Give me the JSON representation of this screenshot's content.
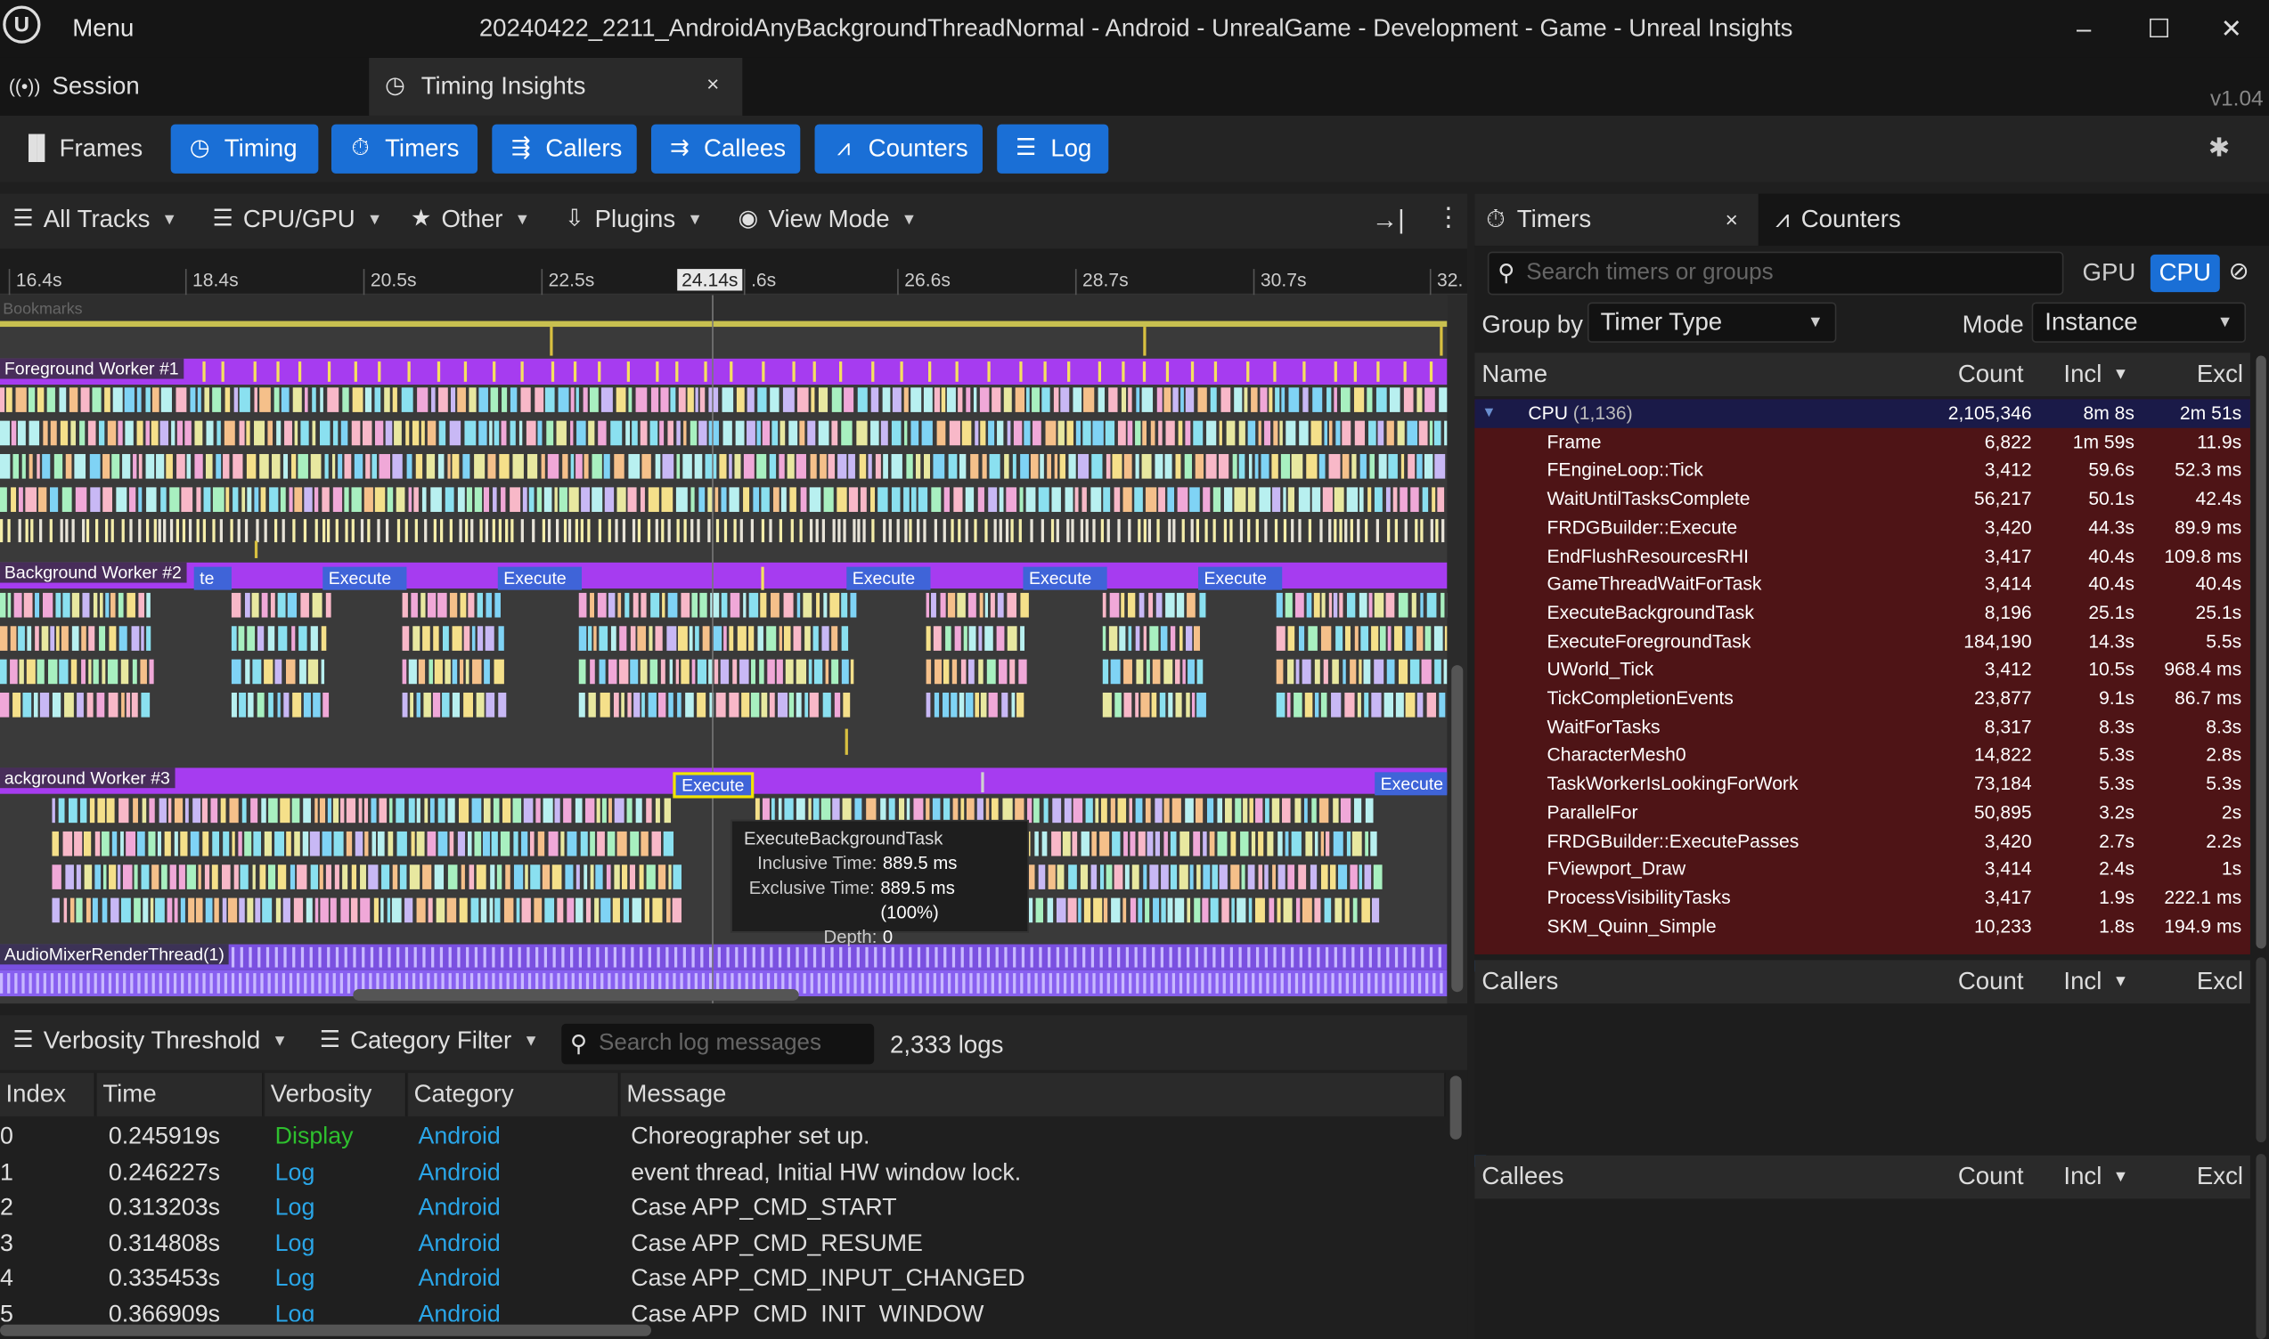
{
  "window": {
    "menu_label": "Menu",
    "title": "20240422_2211_AndroidAnyBackgroundThreadNormal - Android - UnrealGame - Development - Game - Unreal Insights",
    "version": "v1.04"
  },
  "tabs": {
    "session": "Session",
    "timing": "Timing Insights",
    "close": "×"
  },
  "toolbar": {
    "frames": "Frames",
    "timing": "Timing",
    "timers": "Timers",
    "callers": "Callers",
    "callees": "Callees",
    "counters": "Counters",
    "log": "Log"
  },
  "timing_view": {
    "filters": [
      "All Tracks",
      "CPU/GPU",
      "Other",
      "Plugins",
      "View Mode"
    ],
    "ruler_ticks": [
      "16.4s",
      "18.4s",
      "20.5s",
      "22.5s",
      "24.14s",
      ".6s",
      "26.6s",
      "28.7s",
      "30.7s",
      "32."
    ],
    "bookmarks": "Bookmarks",
    "tracks": {
      "fg1": "Foreground Worker #1",
      "bg2": "Background Worker #2",
      "bg3": "ackground Worker #3",
      "audio": "AudioMixerRenderThread(1)"
    },
    "execute_label": "Execute",
    "execute_partial": "te",
    "tooltip": {
      "name": "ExecuteBackgroundTask",
      "inclusive_label": "Inclusive Time:",
      "inclusive_value": "889.5 ms",
      "exclusive_label": "Exclusive Time:",
      "exclusive_value": "889.5 ms (100%)",
      "depth_label": "Depth:",
      "depth_value": "0"
    }
  },
  "log_view": {
    "verbosity_filter": "Verbosity Threshold",
    "category_filter": "Category Filter",
    "search_placeholder": "Search log messages",
    "count": "2,333 logs",
    "columns": [
      "Index",
      "Time",
      "Verbosity",
      "Category",
      "Message"
    ],
    "rows": [
      {
        "index": "0",
        "time": "0.245919s",
        "verbosity": "Display",
        "category": "Android",
        "message": "Choreographer set up."
      },
      {
        "index": "1",
        "time": "0.246227s",
        "verbosity": "Log",
        "category": "Android",
        "message": "event thread, Initial HW window lock."
      },
      {
        "index": "2",
        "time": "0.313203s",
        "verbosity": "Log",
        "category": "Android",
        "message": "Case APP_CMD_START"
      },
      {
        "index": "3",
        "time": "0.314808s",
        "verbosity": "Log",
        "category": "Android",
        "message": "Case APP_CMD_RESUME"
      },
      {
        "index": "4",
        "time": "0.335453s",
        "verbosity": "Log",
        "category": "Android",
        "message": "Case APP_CMD_INPUT_CHANGED"
      },
      {
        "index": "5",
        "time": "0.366909s",
        "verbosity": "Log",
        "category": "Android",
        "message": "Case APP_CMD_INIT_WINDOW"
      }
    ],
    "colors": {
      "display": "#2ec02e",
      "log": "#2aa6e8",
      "category": "#2aa6e8"
    }
  },
  "timers_panel": {
    "tab_timers": "Timers",
    "tab_counters": "Counters",
    "search_placeholder": "Search timers or groups",
    "gpu": "GPU",
    "cpu": "CPU",
    "group_by_label": "Group by",
    "group_by_value": "Timer Type",
    "mode_label": "Mode",
    "mode_value": "Instance",
    "columns": {
      "name": "Name",
      "count": "Count",
      "incl": "Incl",
      "excl": "Excl"
    },
    "group": {
      "name": "CPU",
      "sub": "(1,136)",
      "count": "2,105,346",
      "incl": "8m 8s",
      "excl": "2m 51s"
    },
    "rows": [
      {
        "name": "Frame",
        "count": "6,822",
        "incl": "1m 59s",
        "excl": "11.9s"
      },
      {
        "name": "FEngineLoop::Tick",
        "count": "3,412",
        "incl": "59.6s",
        "excl": "52.3 ms"
      },
      {
        "name": "WaitUntilTasksComplete",
        "count": "56,217",
        "incl": "50.1s",
        "excl": "42.4s"
      },
      {
        "name": "FRDGBuilder::Execute",
        "count": "3,420",
        "incl": "44.3s",
        "excl": "89.9 ms"
      },
      {
        "name": "EndFlushResourcesRHI",
        "count": "3,417",
        "incl": "40.4s",
        "excl": "109.8 ms"
      },
      {
        "name": "GameThreadWaitForTask",
        "count": "3,414",
        "incl": "40.4s",
        "excl": "40.4s"
      },
      {
        "name": "ExecuteBackgroundTask",
        "count": "8,196",
        "incl": "25.1s",
        "excl": "25.1s"
      },
      {
        "name": "ExecuteForegroundTask",
        "count": "184,190",
        "incl": "14.3s",
        "excl": "5.5s"
      },
      {
        "name": "UWorld_Tick",
        "count": "3,412",
        "incl": "10.5s",
        "excl": "968.4 ms"
      },
      {
        "name": "TickCompletionEvents",
        "count": "23,877",
        "incl": "9.1s",
        "excl": "86.7 ms"
      },
      {
        "name": "WaitForTasks",
        "count": "8,317",
        "incl": "8.3s",
        "excl": "8.3s"
      },
      {
        "name": "CharacterMesh0",
        "count": "14,822",
        "incl": "5.3s",
        "excl": "2.8s"
      },
      {
        "name": "TaskWorkerIsLookingForWork",
        "count": "73,184",
        "incl": "5.3s",
        "excl": "5.3s"
      },
      {
        "name": "ParallelFor",
        "count": "50,895",
        "incl": "3.2s",
        "excl": "2s"
      },
      {
        "name": "FRDGBuilder::ExecutePasses",
        "count": "3,420",
        "incl": "2.7s",
        "excl": "2.2s"
      },
      {
        "name": "FViewport_Draw",
        "count": "3,414",
        "incl": "2.4s",
        "excl": "1s"
      },
      {
        "name": "ProcessVisibilityTasks",
        "count": "3,417",
        "incl": "1.9s",
        "excl": "222.1 ms"
      },
      {
        "name": "SKM_Quinn_Simple",
        "count": "10,233",
        "incl": "1.8s",
        "excl": "194.9 ms"
      }
    ],
    "callers": "Callers",
    "callees": "Callees"
  },
  "colors": {
    "accent": "#1a6fd6",
    "track_bar": "#a63cf0",
    "execute_bar": "#3f64d8",
    "timer_rows_bg": "#4e1416"
  }
}
